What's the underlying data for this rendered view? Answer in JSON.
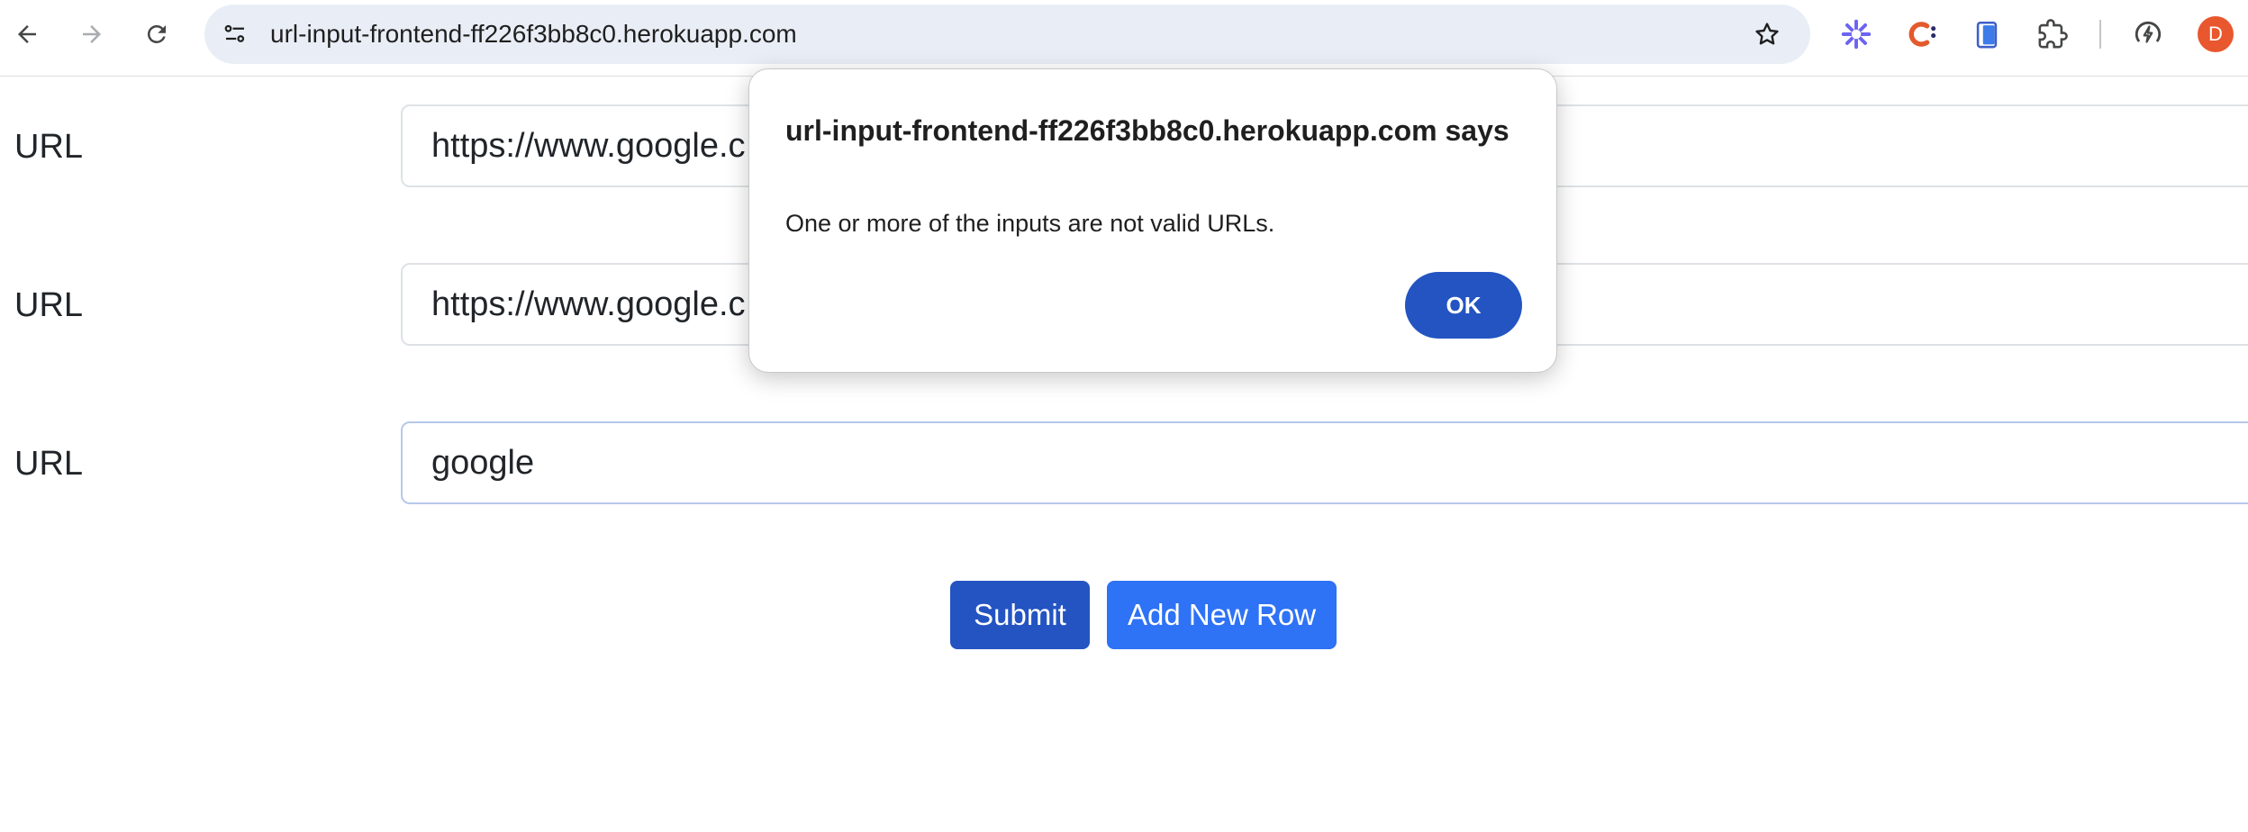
{
  "browser": {
    "url": "url-input-frontend-ff226f3bb8c0.herokuapp.com",
    "profile_initial": "D",
    "icons": {
      "back": "back-arrow-icon",
      "forward": "forward-arrow-icon",
      "reload": "reload-icon",
      "site_settings": "site-settings-icon",
      "bookmark": "star-icon",
      "extensions": [
        "sparkle-extension-icon",
        "c-extension-icon",
        "clipboard-extension-icon",
        "puzzle-extension-icon",
        "performance-icon"
      ]
    }
  },
  "form": {
    "rows": [
      {
        "label": "URL",
        "value": "https://www.google.c"
      },
      {
        "label": "URL",
        "value": "https://www.google.c"
      },
      {
        "label": "URL",
        "value": "google"
      }
    ],
    "submit_label": "Submit",
    "add_row_label": "Add New Row"
  },
  "dialog": {
    "title": "url-input-frontend-ff226f3bb8c0.herokuapp.com says",
    "message": "One or more of the inputs are not valid URLs.",
    "ok_label": "OK"
  },
  "colors": {
    "primary": "#2354c2",
    "secondary_button": "#2e72f5",
    "omnibox": "#e9eef6",
    "profile": "#e8572e"
  }
}
